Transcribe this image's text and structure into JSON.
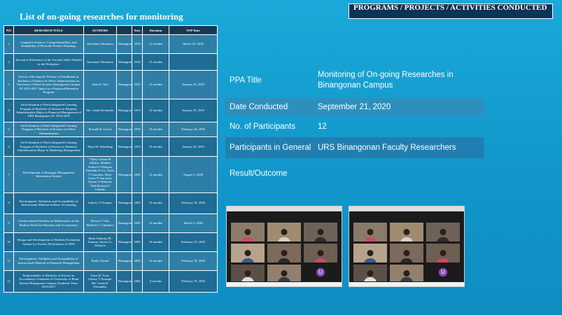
{
  "left_title": "List of on-going researches for monitoring",
  "table": {
    "headers": [
      "NO",
      "RESEARCH TITLE",
      "AUTHORS",
      "Year",
      "Duration",
      "NTP Date"
    ],
    "rows": [
      [
        "1",
        "Linguistic Features, Comprehensibility, and Readability of Pesticide Product Warnings",
        "Sinchanie Dimamoa",
        "Binangonan",
        "2018",
        "12 months",
        "March 22, 2018"
      ],
      [
        "2",
        "Executive Preference of the Ten Soft Skills Needed in the Workplace",
        "Sinchanie Dimamoa",
        "Binangonan",
        "2018",
        "12 months",
        ""
      ],
      [
        "3",
        "Factors Affecting the Decline of Enrollment in Bachelor of Science in Office Administration in University of Rizal System, Binangonan Campus, AY 2013-2017 Input for a Proposed Retention Program",
        "Irene E. Alta",
        "Binangonan",
        "2019",
        "12 months",
        "January 25, 2019"
      ],
      [
        "4",
        "An Evaluation of Work Integrated Learning Program of Bachelor of Science in Business Administration Major in Financial Management of URS Binangonan AY 2016-2018",
        "Ma. Linda Fernandez",
        "Binangonan",
        "2019",
        "12 months",
        "January 25, 2019"
      ],
      [
        "5",
        "An Evaluation of Work Integrated Learning Program of Bachelor of Science in Office Administration",
        "Rosadel R. Corral",
        "Binangonan",
        "2019",
        "10 months",
        "February 20, 2020"
      ],
      [
        "6",
        "An Evaluation of Work Integrated Learning Program of Bachelor of Science in Business Administration Major in Marketing Management",
        "Myra M. Sabadong",
        "Binangonan",
        "2019",
        "10 months",
        "January 25, 2019"
      ],
      [
        "7",
        "Development of Barangay Management Information System",
        "* Baby Ganna M. adhalas, Matthea Andrea O Dalayan, Pinihalla E Go, Oram T Gonzales, Mary Grace P. San Juan, Jayson A Dalayon, Neil Richard S Celadiz",
        "Binangonan",
        "2020",
        "12 months",
        "August 1, 2020"
      ],
      [
        "8",
        "Development, Validation and Acceptability of Instructional Material in Basic Accounting",
        "Liberty T Ocampo",
        "Binangonan",
        "2020",
        "12 months",
        "February 19, 2020"
      ],
      [
        "9",
        "Contextualized Worktext in Mathematics in the Modern World for Business and Accountancy",
        "Florian T Ular, Marlene C. Cabanico",
        "Binangonan",
        "2020",
        "12 months",
        "March 2, 2020"
      ],
      [
        "10",
        "Design and Development of Students Evaluation System for Faculty Performance in URS",
        "Mark Anthony M. Zamora, Jayson A. Dalayon",
        "Binangonan",
        "2020",
        "10 months",
        "February 19, 2020"
      ],
      [
        "11",
        "Development, Validation and Acceptability of Instructional Material in Financial Management",
        "Emily Yosuel",
        "Binangonan",
        "2020",
        "12 months",
        "February 19, 2020"
      ],
      [
        "12",
        "Employability of Bachelor of Science in Accountancy Graduates of University of Rizal System Binangonan Campus Academic Years 2014-2017",
        "Franz D. Tasis, Liberty T Ocampo, Ma. Linda R. Fernandez",
        "Binangonan",
        "2020",
        "6 months",
        "February 19, 2020"
      ]
    ]
  },
  "right_header": "PROGRAMS / PROJECTS / ACTIVITIES CONDUCTED",
  "ppa": [
    {
      "label": "PPA Title",
      "value": "Monitoring of On-going Researches in Binangonan Campus"
    },
    {
      "label": "Date Conducted",
      "value": "September 21, 2020"
    },
    {
      "label": "No. of Participants",
      "value": "12"
    },
    {
      "label": "Participants in General",
      "value": "URS Binangonan Faculty Researchers"
    },
    {
      "label": "Result/Outcome",
      "value": ""
    }
  ],
  "zoom_avatar_letter": "U",
  "colors": {
    "background": "#1197cb",
    "table_header": "#123a57",
    "row_light": "#2e7fa8",
    "row_dark": "#1f6c95"
  }
}
